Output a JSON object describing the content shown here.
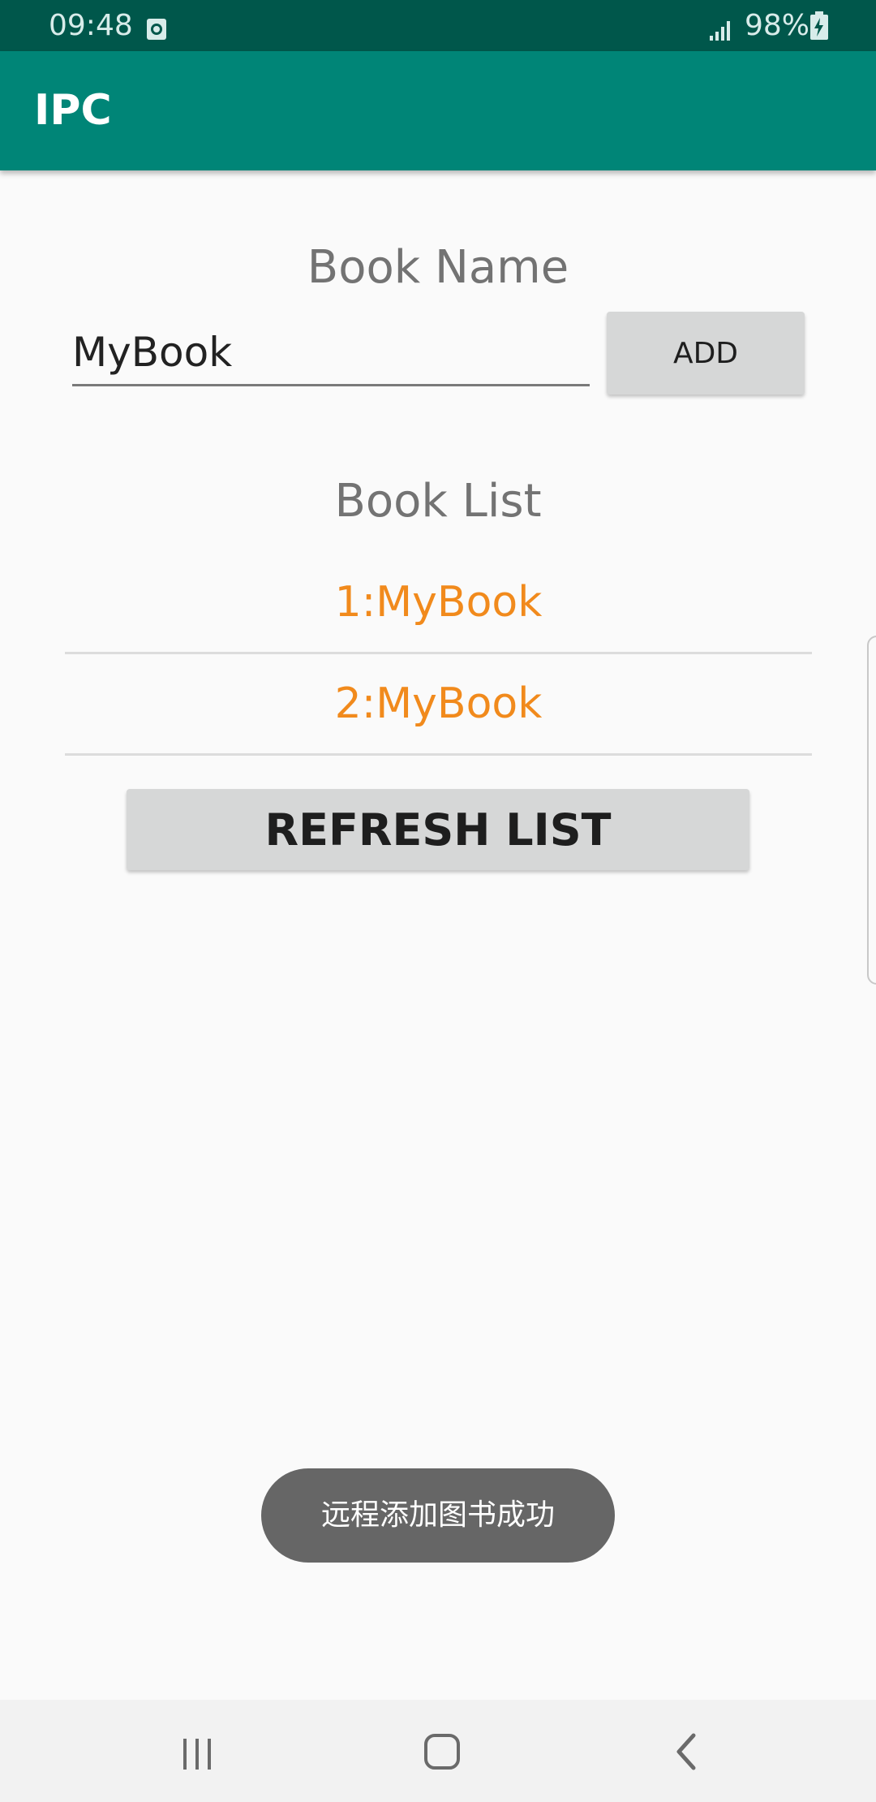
{
  "status_bar": {
    "time": "09:48",
    "battery_percent": "98%",
    "notification_icon": "alarm-icon",
    "signal_icon": "signal-bars-icon",
    "battery_icon": "battery-charging-icon"
  },
  "app_bar": {
    "title": "IPC",
    "color": "#008577"
  },
  "form": {
    "book_name_label": "Book Name",
    "book_name_value": "MyBook",
    "add_button_label": "ADD"
  },
  "list": {
    "label": "Book List",
    "items": [
      "1:MyBook",
      "2:MyBook"
    ],
    "item_color": "#f18a1c"
  },
  "refresh_button_label": "REFRESH LIST",
  "toast": {
    "message": "远程添加图书成功"
  },
  "nav_bar": {
    "recents_icon": "recents-icon",
    "home_icon": "home-icon",
    "back_icon": "back-icon"
  }
}
